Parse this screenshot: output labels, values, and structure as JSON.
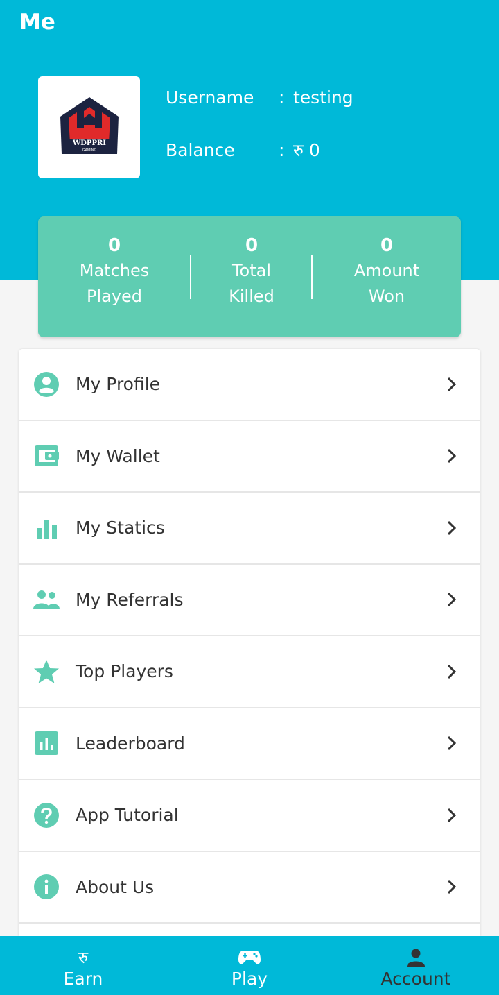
{
  "header": {
    "title": "Me"
  },
  "profile": {
    "logo_text": "WDPPRI",
    "logo_subtext": "GAMING",
    "username_label": "Username",
    "username_sep": ":",
    "username_value": "testing",
    "balance_label": "Balance",
    "balance_sep": ":",
    "balance_value": "रु 0"
  },
  "stats": [
    {
      "value": "0",
      "label_line1": "Matches",
      "label_line2": "Played"
    },
    {
      "value": "0",
      "label_line1": "Total",
      "label_line2": "Killed"
    },
    {
      "value": "0",
      "label_line1": "Amount",
      "label_line2": "Won"
    }
  ],
  "menu": [
    {
      "label": "My Profile",
      "icon": "account-circle-icon"
    },
    {
      "label": "My Wallet",
      "icon": "wallet-icon"
    },
    {
      "label": "My Statics",
      "icon": "bar-chart-icon"
    },
    {
      "label": "My Referrals",
      "icon": "people-icon"
    },
    {
      "label": "Top Players",
      "icon": "star-icon"
    },
    {
      "label": "Leaderboard",
      "icon": "leaderboard-icon"
    },
    {
      "label": "App Tutorial",
      "icon": "help-circle-icon"
    },
    {
      "label": "About Us",
      "icon": "info-circle-icon"
    }
  ],
  "bottom_nav": [
    {
      "label": "Earn",
      "icon_glyph": "रु",
      "icon": "rupee-icon",
      "active": false
    },
    {
      "label": "Play",
      "icon": "gamepad-icon",
      "active": false
    },
    {
      "label": "Account",
      "icon": "person-icon",
      "active": true
    }
  ],
  "colors": {
    "primary": "#00b9d8",
    "accent": "#5fcdb2",
    "text_dark": "#333333"
  }
}
